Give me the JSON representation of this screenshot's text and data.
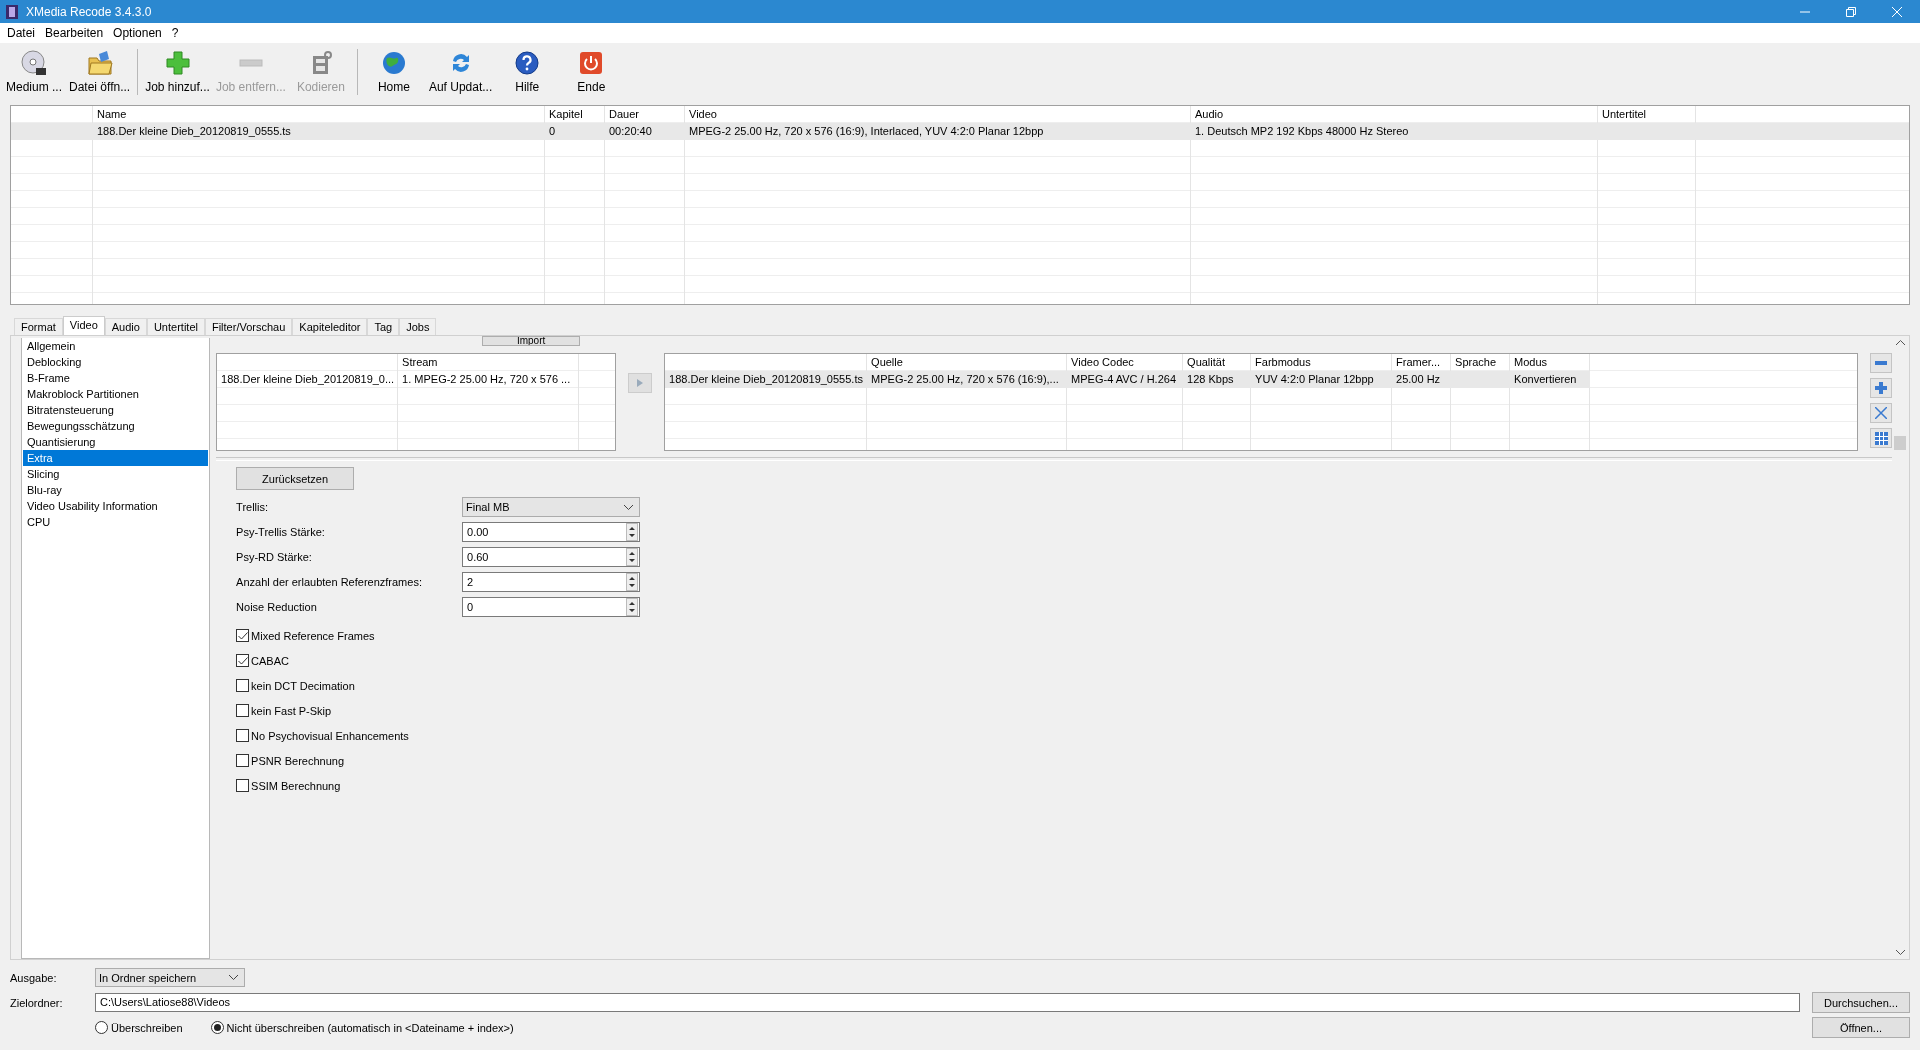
{
  "window": {
    "title": "XMedia Recode 3.4.3.0"
  },
  "menu": [
    "Datei",
    "Bearbeiten",
    "Optionen",
    "?"
  ],
  "toolbar": [
    {
      "kind": "disc",
      "label": "Medium ...",
      "disabled": false
    },
    {
      "kind": "folder",
      "label": "Datei öffn...",
      "disabled": false
    },
    {
      "kind": "separator"
    },
    {
      "kind": "add",
      "label": "Job hinzuf...",
      "disabled": false
    },
    {
      "kind": "remove",
      "label": "Job entfern...",
      "disabled": true
    },
    {
      "kind": "encode",
      "label": "Kodieren",
      "disabled": true
    },
    {
      "kind": "separator"
    },
    {
      "kind": "globe",
      "label": "Home",
      "disabled": false
    },
    {
      "kind": "refresh",
      "label": "Auf Updat...",
      "disabled": false
    },
    {
      "kind": "help",
      "label": "Hilfe",
      "disabled": false
    },
    {
      "kind": "power",
      "label": "Ende",
      "disabled": false
    }
  ],
  "jobs": {
    "columns": [
      "Name",
      "Kapitel",
      "Dauer",
      "Video",
      "Audio",
      "Untertitel"
    ],
    "rows": [
      {
        "selected": true,
        "cells": [
          "188.Der kleine Dieb_20120819_0555.ts",
          "0",
          "00:20:40",
          "MPEG-2 25.00 Hz, 720 x 576 (16:9), Interlaced, YUV 4:2:0 Planar 12bpp",
          "1. Deutsch MP2 192 Kbps 48000 Hz Stereo",
          ""
        ]
      }
    ]
  },
  "tabs": [
    {
      "label": "Format",
      "selected": false
    },
    {
      "label": "Video",
      "selected": true
    },
    {
      "label": "Audio",
      "selected": false
    },
    {
      "label": "Untertitel",
      "selected": false
    },
    {
      "label": "Filter/Vorschau",
      "selected": false
    },
    {
      "label": "Kapiteleditor",
      "selected": false
    },
    {
      "label": "Tag",
      "selected": false
    },
    {
      "label": "Jobs",
      "selected": false
    }
  ],
  "sidebar": {
    "items": [
      {
        "label": "Allgemein",
        "selected": false
      },
      {
        "label": "Deblocking",
        "selected": false
      },
      {
        "label": "B-Frame",
        "selected": false
      },
      {
        "label": "Makroblock Partitionen",
        "selected": false
      },
      {
        "label": "Bitratensteuerung",
        "selected": false
      },
      {
        "label": "Bewegungsschätzung",
        "selected": false
      },
      {
        "label": "Quantisierung",
        "selected": false
      },
      {
        "label": "Extra",
        "selected": true
      },
      {
        "label": "Slicing",
        "selected": false
      },
      {
        "label": "Blu-ray",
        "selected": false
      },
      {
        "label": "Video Usability Information",
        "selected": false
      },
      {
        "label": "CPU",
        "selected": false
      }
    ]
  },
  "import_button": "Import",
  "source": {
    "columns": [
      "",
      "Stream"
    ],
    "rows": [
      [
        "188.Der kleine Dieb_20120819_0...",
        "1. MPEG-2 25.00 Hz, 720 x 576 ..."
      ]
    ]
  },
  "target": {
    "columns": [
      "",
      "Quelle",
      "Video Codec",
      "Qualität",
      "Farbmodus",
      "Framer...",
      "Sprache",
      "Modus"
    ],
    "rows": [
      [
        "188.Der kleine Dieb_20120819_0555.ts",
        "MPEG-2 25.00 Hz, 720 x 576 (16:9),...",
        "MPEG-4 AVC / H.264",
        "128 Kbps",
        "YUV 4:2:0 Planar 12bpp",
        "25.00 Hz",
        "",
        "Konvertieren"
      ]
    ]
  },
  "reset_button": "Zurücksetzen",
  "settings": [
    {
      "kind": "select",
      "label": "Trellis:",
      "value": "Final MB"
    },
    {
      "kind": "spin",
      "label": "Psy-Trellis Stärke:",
      "value": "0.00"
    },
    {
      "kind": "spin",
      "label": "Psy-RD Stärke:",
      "value": "0.60"
    },
    {
      "kind": "spin",
      "label": "Anzahl der erlaubten Referenzframes:",
      "value": "2"
    },
    {
      "kind": "spin",
      "label": "Noise Reduction",
      "value": "0"
    }
  ],
  "options": [
    {
      "label": "Mixed Reference Frames",
      "checked": true
    },
    {
      "label": "CABAC",
      "checked": true
    },
    {
      "label": "kein DCT Decimation",
      "checked": false
    },
    {
      "label": "kein Fast P-Skip",
      "checked": false
    },
    {
      "label": "No Psychovisual Enhancements",
      "checked": false
    },
    {
      "label": "PSNR Berechnung",
      "checked": false
    },
    {
      "label": "SSIM Berechnung",
      "checked": false
    }
  ],
  "output": {
    "label": "Ausgabe:",
    "value": "In Ordner speichern"
  },
  "folder": {
    "label": "Zielordner:",
    "value": "C:\\Users\\Latiose88\\Videos",
    "browse": "Durchsuchen...",
    "open": "Öffnen..."
  },
  "overwrite": [
    {
      "label": "Überschreiben",
      "selected": false
    },
    {
      "label": "Nicht überschreiben (automatisch in <Dateiname + index>)",
      "selected": true
    }
  ]
}
